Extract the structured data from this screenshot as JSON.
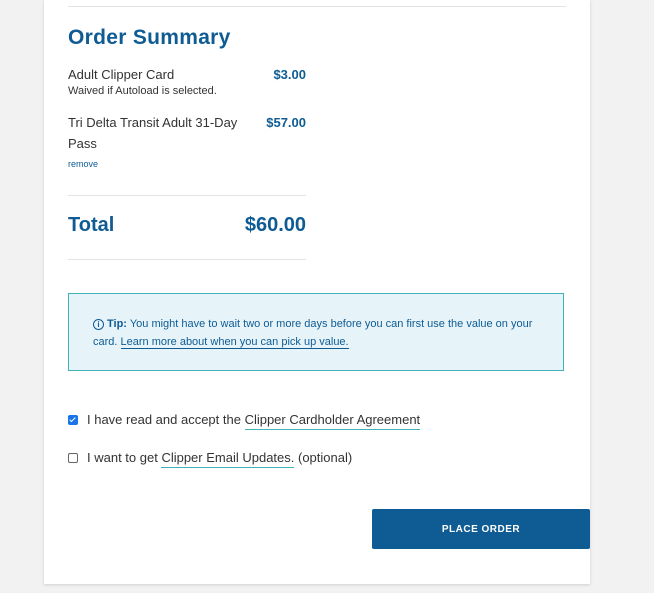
{
  "order_summary": {
    "title": "Order Summary",
    "items": [
      {
        "name": "Adult Clipper Card",
        "price": "$3.00",
        "note": "Waived if Autoload is selected."
      },
      {
        "name": "Tri Delta Transit Adult 31-Day Pass",
        "price": "$57.00",
        "action": "remove"
      }
    ],
    "total_label": "Total",
    "total_value": "$60.00"
  },
  "tip": {
    "icon": "info-circle-icon",
    "label": "Tip:",
    "text": " You might have to wait two or more days before you can first use the value on your card. ",
    "link": "Learn more about when you can pick up value."
  },
  "agreements": {
    "cardholder": {
      "checked": true,
      "prefix": "I have read and accept the ",
      "link": "Clipper Cardholder Agreement"
    },
    "email_updates": {
      "checked": false,
      "prefix": "I want to get ",
      "link": "Clipper Email Updates.",
      "suffix": " (optional)"
    }
  },
  "place_order_label": "PLACE ORDER",
  "colors": {
    "brand_blue": "#0f5b93",
    "tip_border": "#3fb3b8",
    "tip_background": "#e6f4fa"
  }
}
